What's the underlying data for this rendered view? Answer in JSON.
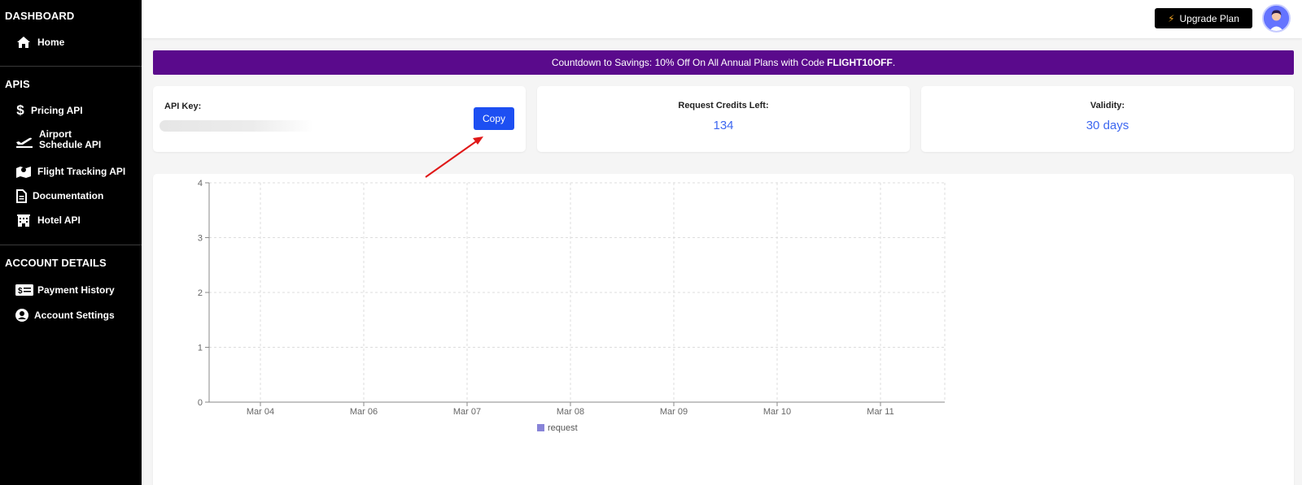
{
  "sidebar": {
    "dashboard_title": "DASHBOARD",
    "home_label": "Home",
    "apis_title": "APIS",
    "items": [
      {
        "label": "Pricing API",
        "icon": "dollar-icon"
      },
      {
        "label": "Airport Schedule API",
        "icon": "plane-departure-icon"
      },
      {
        "label": "Flight Tracking API",
        "icon": "map-marker-icon"
      },
      {
        "label": "Documentation",
        "icon": "file-icon"
      },
      {
        "label": "Hotel API",
        "icon": "hotel-icon"
      }
    ],
    "account_title": "ACCOUNT DETAILS",
    "account_items": [
      {
        "label": "Payment History",
        "icon": "money-bill-icon"
      },
      {
        "label": "Account Settings",
        "icon": "user-circle-icon"
      }
    ]
  },
  "header": {
    "upgrade_label": "Upgrade Plan",
    "upgrade_icon": "bolt-icon"
  },
  "banner": {
    "text": "Countdown to Savings: 10% Off On All Annual Plans with Code ",
    "code": "FLIGHT10OFF",
    "suffix": "."
  },
  "api_card": {
    "label": "API Key:",
    "copy_label": "Copy"
  },
  "credits_card": {
    "label": "Request Credits Left:",
    "value": "134"
  },
  "validity_card": {
    "label": "Validity:",
    "value": "30 days"
  },
  "colors": {
    "accent_blue": "#1d4ff2",
    "value_blue": "#3d67f0",
    "banner_purple": "#5a0a8c",
    "legend_swatch": "#8884d8"
  },
  "chart_data": {
    "type": "line",
    "categories": [
      "Mar 04",
      "Mar 06",
      "Mar 07",
      "Mar 08",
      "Mar 09",
      "Mar 10",
      "Mar 11"
    ],
    "y_ticks": [
      "0",
      "1",
      "2",
      "3",
      "4"
    ],
    "ylim": [
      0,
      4
    ],
    "series": [
      {
        "name": "request",
        "values": []
      }
    ],
    "grid": true,
    "legend": "bottom"
  }
}
